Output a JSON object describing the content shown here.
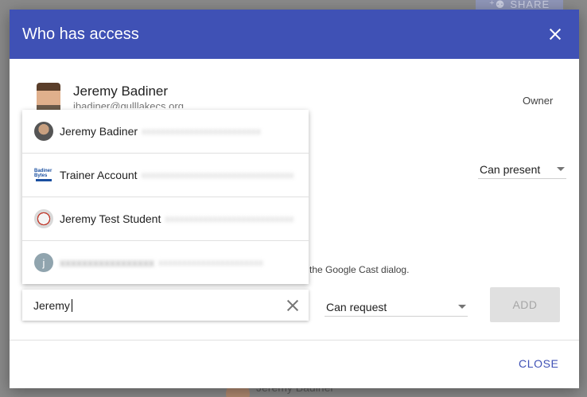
{
  "background": {
    "share_label": "SHARE",
    "bottom_name": "Jeremy Badiner"
  },
  "dialog": {
    "title": "Who has access",
    "owner": {
      "name": "Jeremy Badiner",
      "email": "jbadiner@gulllakecs.org",
      "role": "Owner"
    },
    "present_permission": "Can present",
    "cast_note": "n the Google Cast dialog.",
    "suggestions": [
      {
        "name": "Jeremy Badiner",
        "avatar": "photo-avatar"
      },
      {
        "name": "Trainer Account",
        "avatar": "logo-avatar",
        "logo_text": "Badiner Bytes"
      },
      {
        "name": "Jeremy Test Student",
        "avatar": "badge-avatar"
      },
      {
        "name": "",
        "avatar": "letter-avatar",
        "letter": "j"
      }
    ],
    "search": {
      "value": "Jeremy"
    },
    "request_permission": "Can request",
    "add_label": "ADD",
    "close_label": "CLOSE"
  },
  "colors": {
    "header": "#3f51b5",
    "link": "#3f51b5",
    "disabled_button": "#e0e0e0"
  }
}
